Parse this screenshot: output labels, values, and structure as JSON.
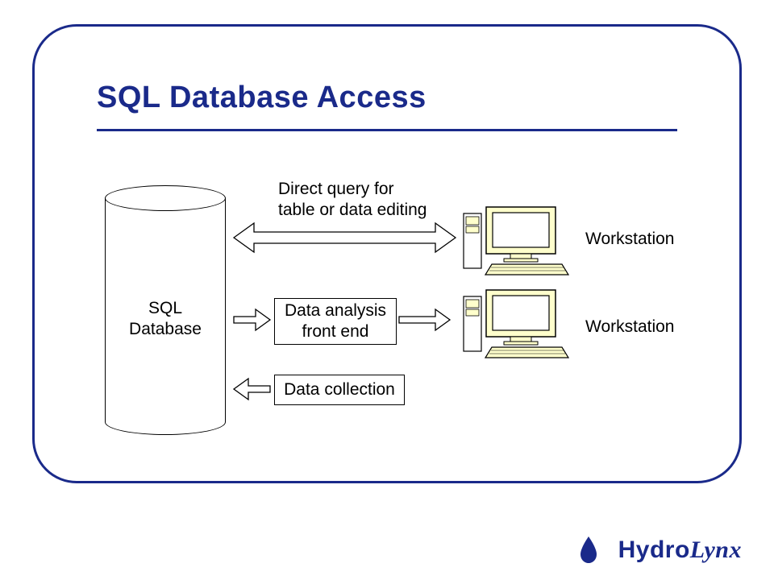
{
  "title": "SQL Database Access",
  "database_label": "SQL\nDatabase",
  "direct_query_label": "Direct query for\ntable or data editing",
  "workstation_label_1": "Workstation",
  "workstation_label_2": "Workstation",
  "analysis_box": "Data analysis\nfront end",
  "collection_box": "Data collection",
  "logo_prefix": "Hydro",
  "logo_suffix": "Lynx"
}
